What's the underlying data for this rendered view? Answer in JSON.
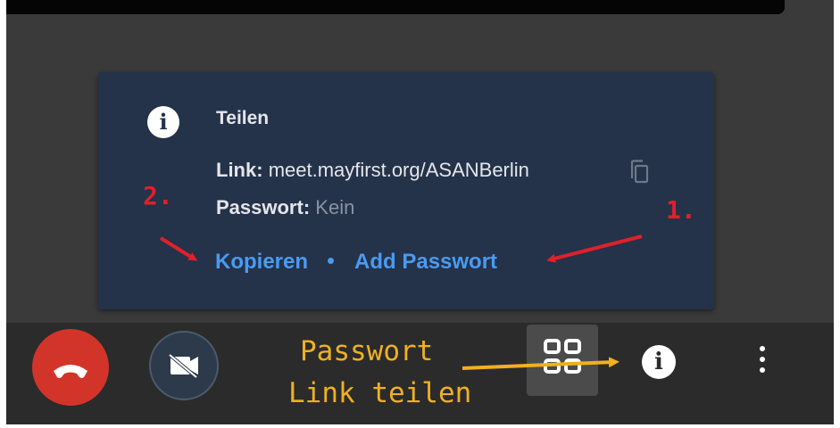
{
  "info_panel": {
    "icon": "info-icon",
    "title": "Teilen",
    "link_label": "Link:",
    "link_value": "meet.mayfirst.org/ASANBerlin",
    "copy_icon": "copy-icon",
    "password_label": "Passwort:",
    "password_value": "Kein",
    "copy_action": "Kopieren",
    "add_password_action": "Add Passwort"
  },
  "toolbar": {
    "hangup_icon": "phone-hangup-icon",
    "camera_icon": "camera-off-icon",
    "tile_icon": "tile-view-icon",
    "info_icon": "info-icon",
    "more_icon": "more-vertical-icon"
  },
  "annotations": {
    "step_one": "1.",
    "step_two": "2.",
    "note_line1": "Passwort",
    "note_line2": "Link teilen"
  },
  "colors": {
    "panel_bg": "#24324a",
    "link_blue": "#4a9bf0",
    "hangup_red": "#d3342a",
    "annotation_yellow": "#f0b020",
    "annotation_red": "#e0202a"
  }
}
